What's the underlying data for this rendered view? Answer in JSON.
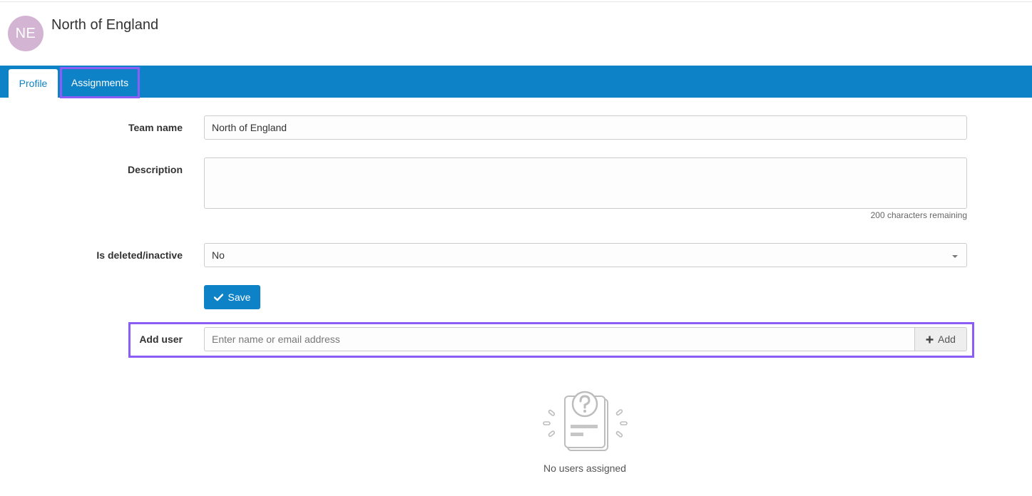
{
  "header": {
    "avatar_initials": "NE",
    "title": "North of England"
  },
  "tabs": [
    {
      "label": "Profile",
      "active": true
    },
    {
      "label": "Assignments",
      "active": false
    }
  ],
  "form": {
    "team_name_label": "Team name",
    "team_name_value": "North of England",
    "description_label": "Description",
    "description_value": "",
    "char_remaining": "200 characters remaining",
    "inactive_label": "Is deleted/inactive",
    "inactive_value": "No",
    "save_label": "Save"
  },
  "add_user": {
    "label": "Add user",
    "placeholder": "Enter name or email address",
    "button_label": "Add"
  },
  "empty_state": {
    "icon": "question-document-icon",
    "text": "No users assigned"
  },
  "colors": {
    "brand": "#0d82c6",
    "highlight": "#8b5cf6",
    "avatar": "#d3b4d3"
  }
}
